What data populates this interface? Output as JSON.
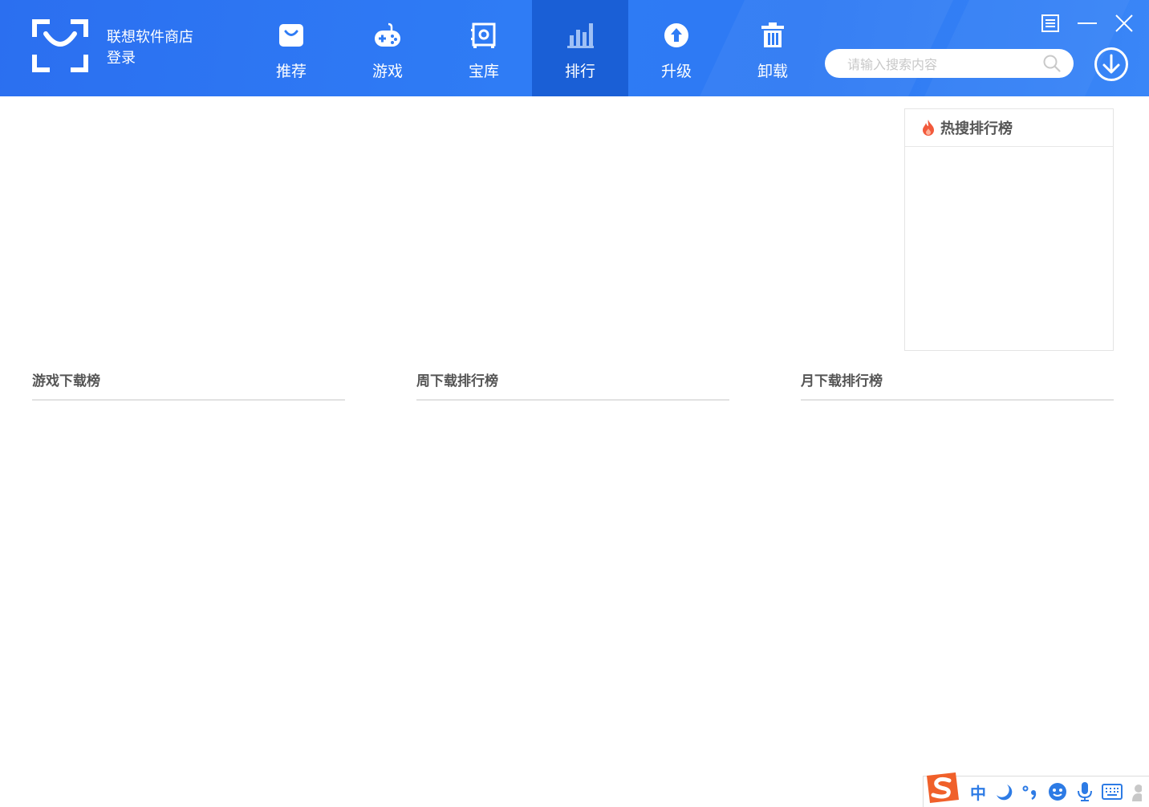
{
  "app": {
    "name": "联想软件商店",
    "login_label": "登录"
  },
  "nav": {
    "items": [
      {
        "label": "推荐",
        "icon": "bag-icon"
      },
      {
        "label": "游戏",
        "icon": "gamepad-icon"
      },
      {
        "label": "宝库",
        "icon": "vault-icon"
      },
      {
        "label": "排行",
        "icon": "bar-chart-icon",
        "active": true
      },
      {
        "label": "升级",
        "icon": "upgrade-arrow-icon"
      },
      {
        "label": "卸载",
        "icon": "trash-icon"
      }
    ]
  },
  "search": {
    "placeholder": "请输入搜索内容"
  },
  "hot_search": {
    "title": "热搜排行榜",
    "icon": "flame-icon"
  },
  "rankings": {
    "games_title": "游戏下载榜",
    "weekly_title": "周下载排行榜",
    "monthly_title": "月下载排行榜"
  },
  "ime": {
    "mode_label": "中"
  },
  "colors": {
    "header_blue": "#2d79f3",
    "active_tab": "#1a5fd6",
    "flame": "#f25a3c",
    "ime_accent": "#2d7be5"
  }
}
